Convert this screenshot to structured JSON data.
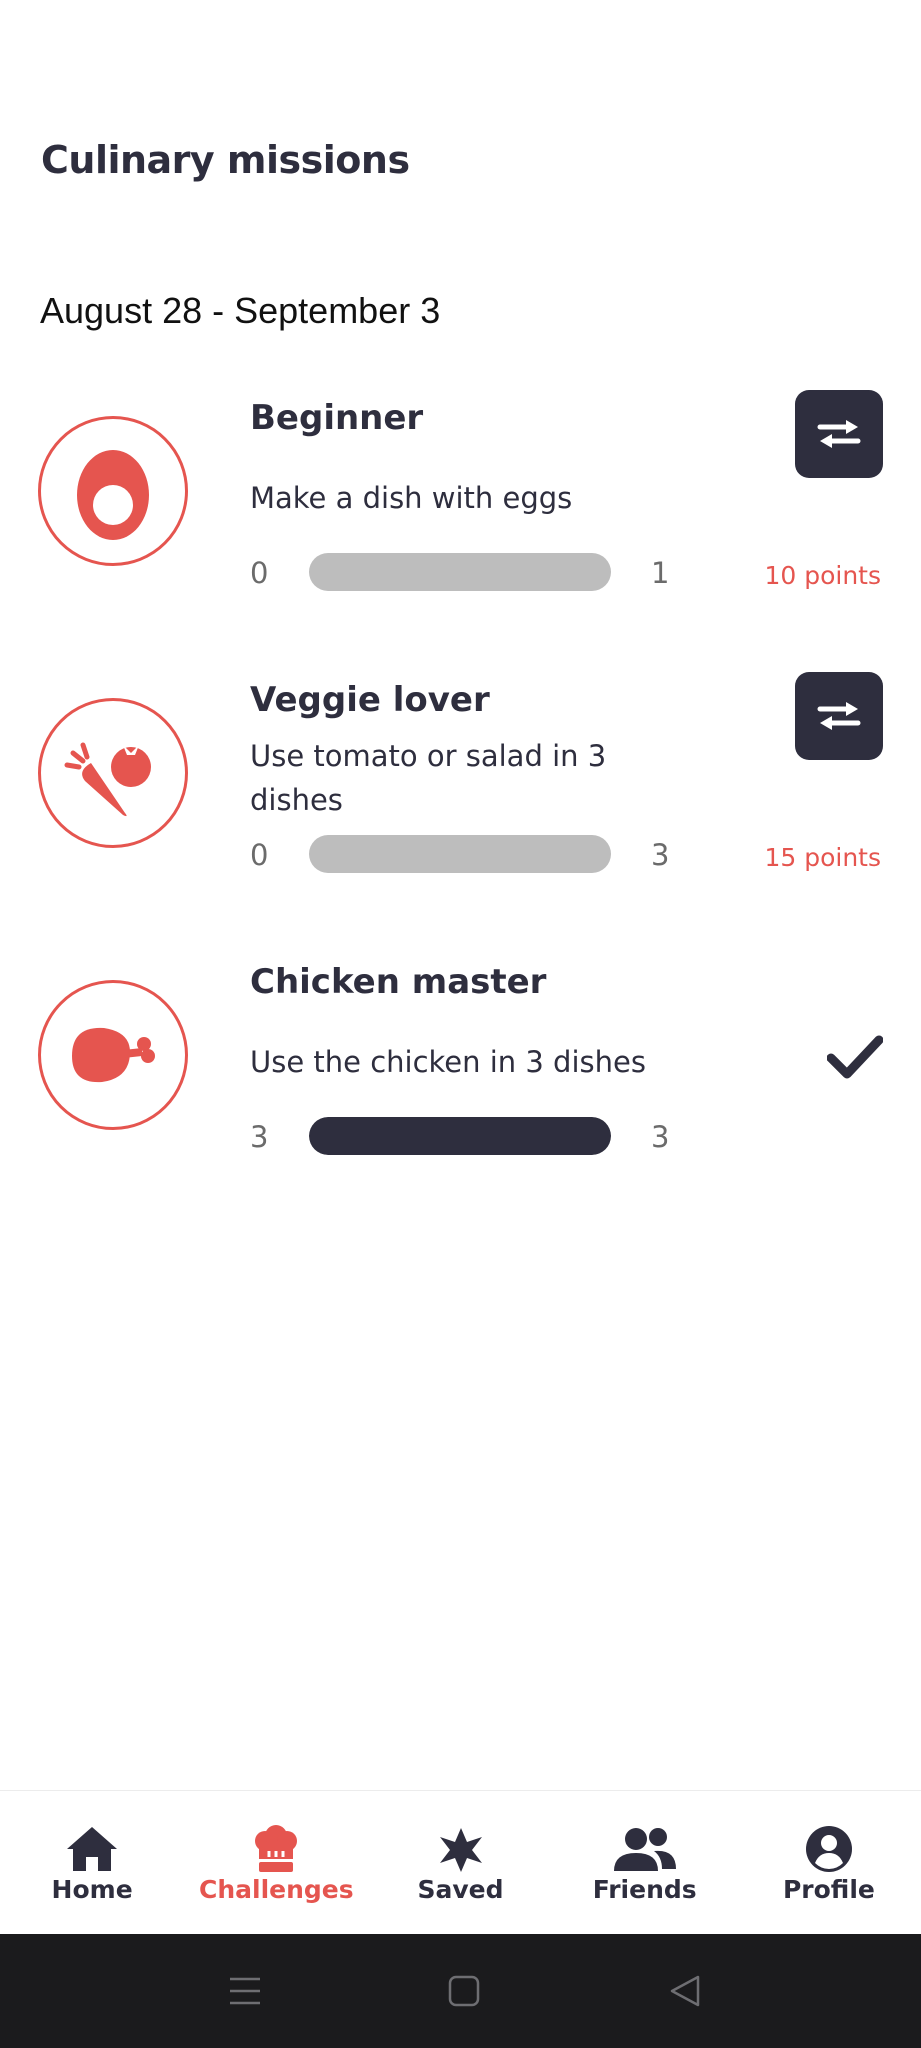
{
  "header": {
    "title": "Culinary missions"
  },
  "week": {
    "range": "August 28 - September 3"
  },
  "missions": [
    {
      "title": "Beginner",
      "description": "Make a dish with eggs",
      "progress_current": "0",
      "progress_target": "1",
      "progress_fraction": 0,
      "points": "10 points",
      "icon": "egg-icon",
      "action": "swap-icon"
    },
    {
      "title": "Veggie lover",
      "description": "Use tomato or salad in 3 dishes",
      "progress_current": "0",
      "progress_target": "3",
      "progress_fraction": 0,
      "points": "15 points",
      "icon": "vegetables-icon",
      "action": "swap-icon"
    },
    {
      "title": "Chicken master",
      "description": "Use the chicken in 3 dishes",
      "progress_current": "3",
      "progress_target": "3",
      "progress_fraction": 1,
      "icon": "chicken-leg-icon",
      "action": "check-icon"
    }
  ],
  "nav": {
    "items": [
      {
        "label": "Home",
        "icon": "home-icon",
        "active": false
      },
      {
        "label": "Challenges",
        "icon": "chef-hat-icon",
        "active": true
      },
      {
        "label": "Saved",
        "icon": "star-icon",
        "active": false
      },
      {
        "label": "Friends",
        "icon": "friends-icon",
        "active": false
      },
      {
        "label": "Profile",
        "icon": "profile-icon",
        "active": false
      }
    ]
  },
  "colors": {
    "accent": "#e5554f",
    "dark": "#2e2e3e",
    "track": "#bdbdbd",
    "system_bar": "#1b1b1d"
  }
}
